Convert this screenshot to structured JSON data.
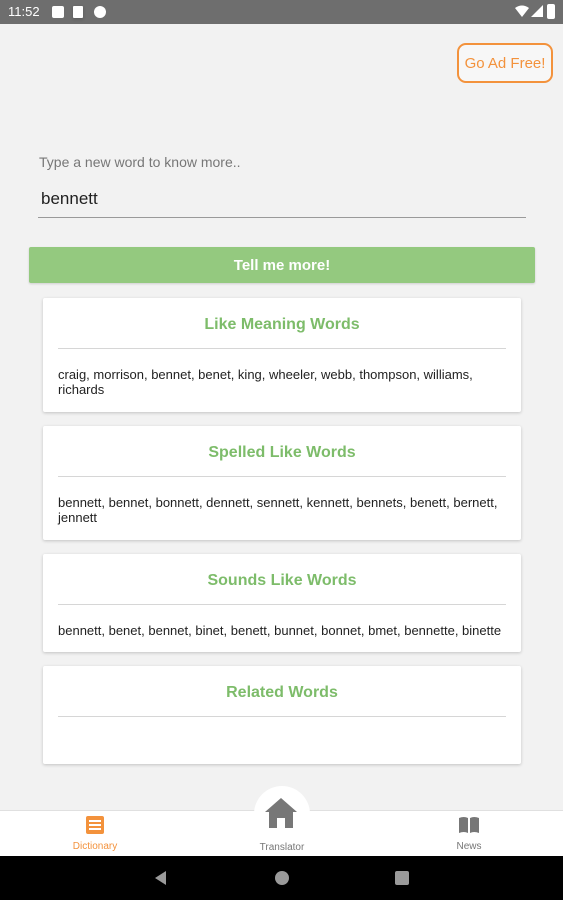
{
  "status_bar": {
    "time": "11:52"
  },
  "header": {
    "ad_free_button": "Go Ad Free!"
  },
  "search": {
    "label": "Type a new word to know more..",
    "value": "bennett",
    "button_label": "Tell me more!"
  },
  "cards": [
    {
      "title": "Like Meaning Words",
      "words": "craig, morrison, bennet, benet, king, wheeler, webb, thompson, williams, richards"
    },
    {
      "title": "Spelled Like Words",
      "words": "bennett, bennet, bonnett, dennett, sennett, kennett, bennets, benett, bernett, jennett"
    },
    {
      "title": "Sounds Like Words",
      "words": "bennett, benet, bennet, binet, benett, bunnet, bonnet, bmet, bennette, binette"
    },
    {
      "title": "Related Words",
      "words": ""
    }
  ],
  "bottom_nav": {
    "items": [
      {
        "label": "Dictionary",
        "icon": "list-icon",
        "active": true
      },
      {
        "label": "Translator",
        "icon": "home-icon",
        "active": false
      },
      {
        "label": "News",
        "icon": "book-icon",
        "active": false
      }
    ]
  },
  "colors": {
    "accent_orange": "#f3923c",
    "green": "#7dbc6a",
    "button_green": "#94c97f"
  }
}
